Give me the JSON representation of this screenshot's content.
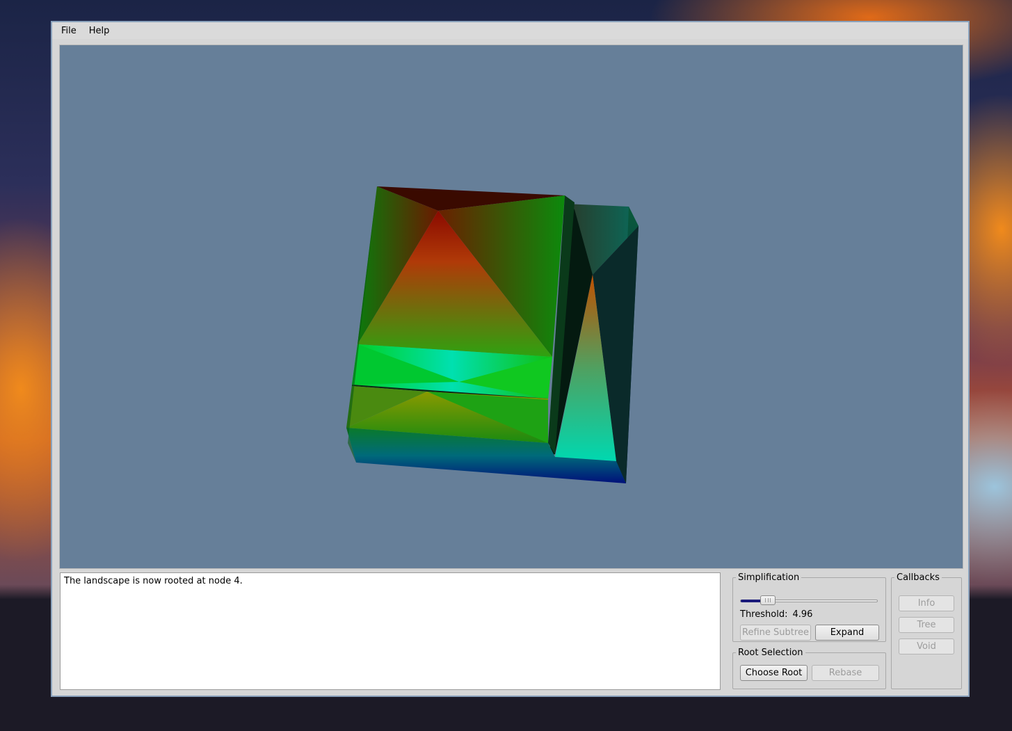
{
  "menu": {
    "file": "File",
    "help": "Help"
  },
  "log": {
    "text": "The landscape is now rooted at node 4."
  },
  "simplification": {
    "title": "Simplification",
    "threshold_label": "Threshold:",
    "threshold_value": "4.96",
    "slider_fraction": 0.2,
    "refine_label": "Refine Subtree",
    "expand_label": "Expand"
  },
  "root_selection": {
    "title": "Root Selection",
    "choose_label": "Choose Root",
    "rebase_label": "Rebase"
  },
  "callbacks": {
    "title": "Callbacks",
    "info_label": "Info",
    "tree_label": "Tree",
    "void_label": "Void"
  },
  "colors": {
    "viewport_background": "#667f99",
    "slider_fill": "#1a1a7a"
  }
}
